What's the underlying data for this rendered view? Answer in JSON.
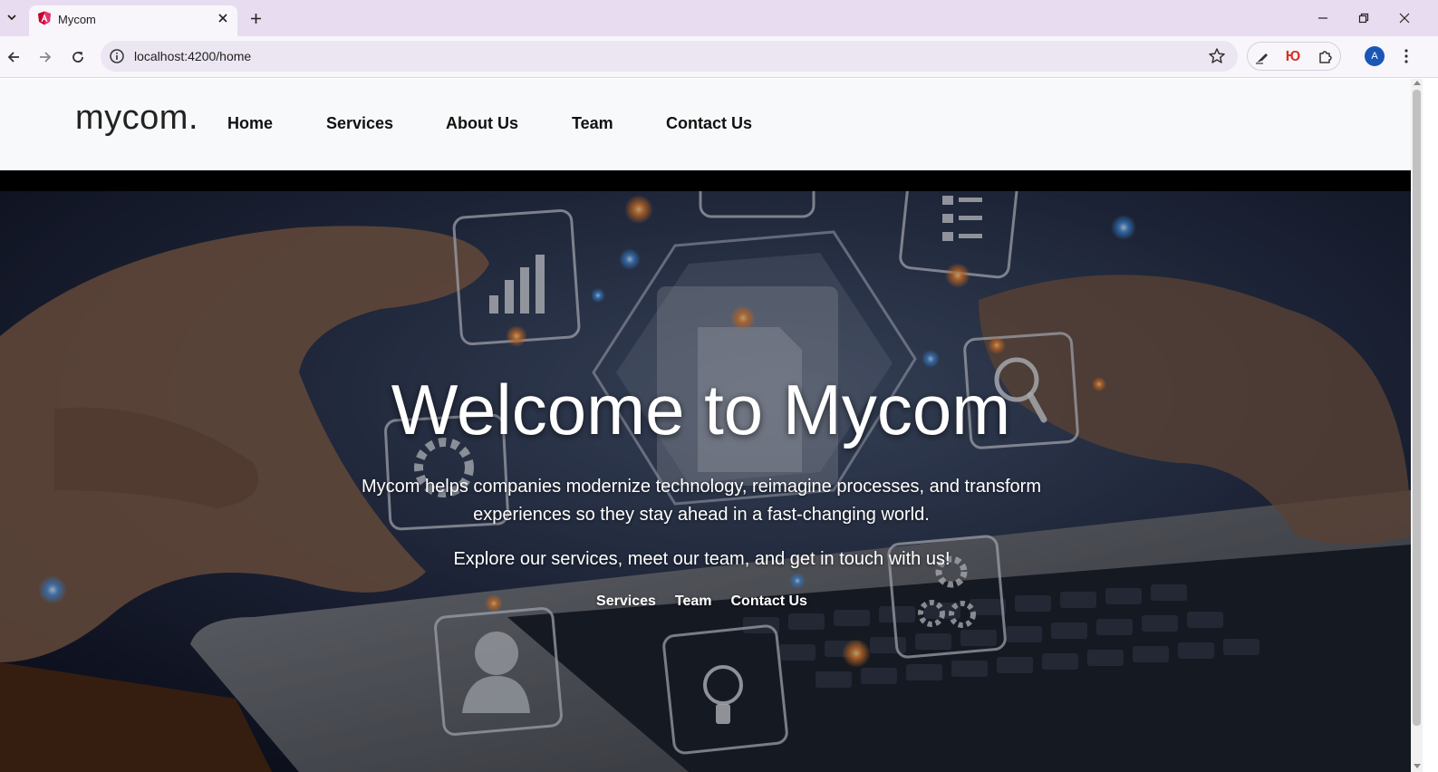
{
  "browser": {
    "tab_title": "Mycom",
    "url": "localhost:4200/home",
    "profile_initial": "A",
    "extension_label": "Ю",
    "accent": "#e8ddf0"
  },
  "site": {
    "logo": "mycom.",
    "nav": [
      "Home",
      "Services",
      "About Us",
      "Team",
      "Contact Us"
    ]
  },
  "hero": {
    "title": "Welcome to Mycom",
    "description": "Mycom helps companies modernize technology, reimagine processes, and transform experiences so they stay ahead in a fast-changing world.",
    "explore": "Explore our services, meet our team, and get in touch with us!",
    "links": [
      "Services",
      "Team",
      "Contact Us"
    ]
  }
}
